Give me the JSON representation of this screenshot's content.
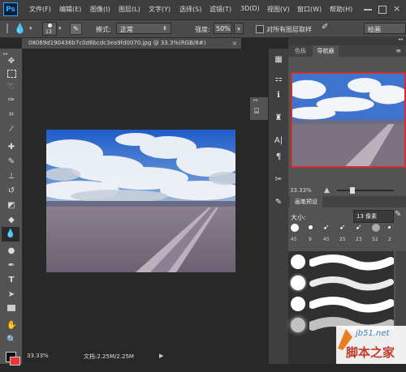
{
  "app": {
    "logo": "Ps"
  },
  "menu": [
    "文件(F)",
    "编辑(E)",
    "图像(I)",
    "图层(L)",
    "文字(Y)",
    "选择(S)",
    "滤镜(T)",
    "3D(D)",
    "视图(V)",
    "窗口(W)",
    "帮助(H)"
  ],
  "options": {
    "brush_size": "13",
    "mode_label": "模式:",
    "mode_value": "正常",
    "strength_label": "强度:",
    "strength_value": "50%",
    "sample_all_label": "对所有图层取样",
    "workspace": "绘画"
  },
  "document": {
    "tab_title": "08069d190436b7c0d6bcdc3ea9fd0070.jpg @ 33.3%(RGB/8#)",
    "close": "×"
  },
  "status": {
    "zoom": "33.33%",
    "doc_size": "文档:2.25M/2.25M"
  },
  "panels": {
    "top_tabs": [
      "色板",
      "导航器"
    ],
    "navigator_zoom": "33.33%",
    "brush_tab": "画笔预设",
    "size_label": "大小:",
    "size_value": "13 像素",
    "presets": [
      "45",
      "9",
      "45",
      "25",
      "23",
      "52",
      "2"
    ]
  },
  "watermark": {
    "line1": "jb51.net",
    "line2": "脚本之家"
  },
  "colors": {
    "accent": "#31a8ff",
    "nav_frame": "#d03030"
  }
}
